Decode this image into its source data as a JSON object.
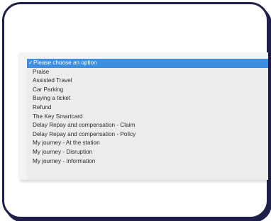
{
  "dropdown": {
    "selected_check": "✓",
    "options": [
      {
        "label": "Please choose an option"
      },
      {
        "label": "Praise"
      },
      {
        "label": "Assisted Travel"
      },
      {
        "label": "Car Parking"
      },
      {
        "label": "Buying a ticket"
      },
      {
        "label": "Refund"
      },
      {
        "label": "The Key Smartcard"
      },
      {
        "label": "Delay Repay and compensation - Claim"
      },
      {
        "label": "Delay Repay and compensation - Policy"
      },
      {
        "label": "My journey - At the station"
      },
      {
        "label": "My journey - Disruption"
      },
      {
        "label": "My journey - Information"
      }
    ]
  },
  "colors": {
    "frame_border": "#1f1f4a",
    "selection": "#3b8ee0",
    "menu_background": "#ececec"
  }
}
